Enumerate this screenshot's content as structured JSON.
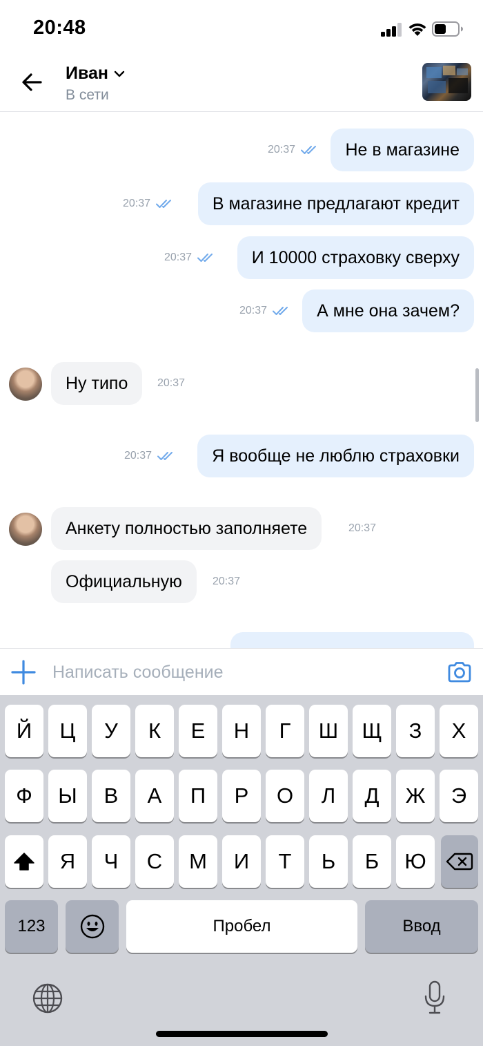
{
  "status_bar": {
    "time": "20:48"
  },
  "header": {
    "contact_name": "Иван",
    "presence": "В сети"
  },
  "messages": [
    {
      "direction": "out",
      "text": "Не в магазине",
      "time": "20:37",
      "read": true
    },
    {
      "direction": "out",
      "text": "В магазине предлагают кредит",
      "time": "20:37",
      "read": true
    },
    {
      "direction": "out",
      "text": "И 10000 страховку сверху",
      "time": "20:37",
      "read": true
    },
    {
      "direction": "out",
      "text": "А мне она зачем?",
      "time": "20:37",
      "read": true
    },
    {
      "direction": "in",
      "text": "Ну типо",
      "time": "20:37"
    },
    {
      "direction": "out",
      "text": "Я вообще не люблю страховки",
      "time": "20:37",
      "read": true
    },
    {
      "direction": "in",
      "text": "Анкету полностью заполняете",
      "time": "20:37"
    },
    {
      "direction": "in",
      "text": "Официальную",
      "time": "20:37"
    }
  ],
  "composer": {
    "placeholder": "Написать сообщение"
  },
  "keyboard": {
    "row1": [
      "Й",
      "Ц",
      "У",
      "К",
      "Е",
      "Н",
      "Г",
      "Ш",
      "Щ",
      "З",
      "Х"
    ],
    "row2": [
      "Ф",
      "Ы",
      "В",
      "А",
      "П",
      "Р",
      "О",
      "Л",
      "Д",
      "Ж",
      "Э"
    ],
    "row3": [
      "Я",
      "Ч",
      "С",
      "М",
      "И",
      "Т",
      "Ь",
      "Б",
      "Ю"
    ],
    "numbers_label": "123",
    "space_label": "Пробел",
    "return_label": "Ввод"
  },
  "colors": {
    "outgoing_bubble": "#e5f0fd",
    "incoming_bubble": "#f2f3f5",
    "accent": "#3f8ae0",
    "read_check": "#71aaeb",
    "meta_text": "#99a2ad",
    "keyboard_bg": "#d1d3d9"
  },
  "icons": [
    "back-arrow",
    "chevron-down",
    "double-check",
    "plus",
    "camera",
    "shift",
    "backspace",
    "emoji",
    "globe",
    "microphone"
  ]
}
